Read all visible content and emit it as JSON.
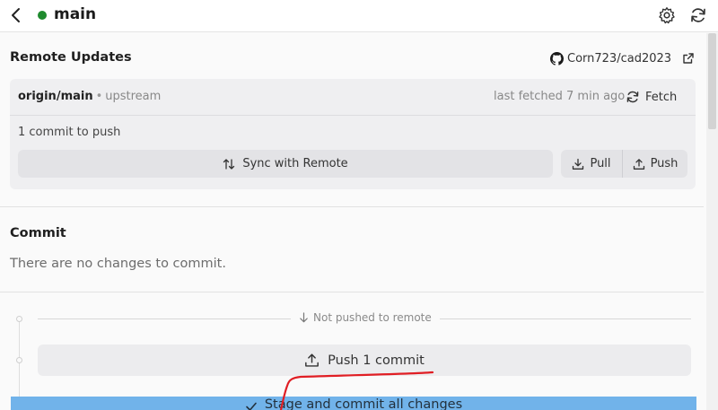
{
  "header": {
    "branch_name": "main",
    "status_color": "#1f8a2e",
    "back_icon": "chevron-left-icon",
    "settings_icon": "gear-icon",
    "refresh_icon": "refresh-icon"
  },
  "remote_updates": {
    "title": "Remote Updates",
    "repo_link": "Corn723/cad2023",
    "repo_icon": "github-icon",
    "external_icon": "external-link-icon",
    "upstream_branch": "origin/main",
    "separator": "•",
    "upstream_label": "upstream",
    "last_fetched": "last fetched 7 min ago",
    "fetch_label": "Fetch",
    "commits_to_push": "1 commit to push",
    "sync_label": "Sync with Remote",
    "pull_label": "Pull",
    "push_label": "Push"
  },
  "commit": {
    "title": "Commit",
    "empty_message": "There are no changes to commit.",
    "not_pushed_label": "Not pushed to remote",
    "push_commit_label": "Push 1 commit",
    "stage_commit_label": "Stage and commit all changes"
  },
  "colors": {
    "accent": "#71b3ea",
    "annotation": "#e01e24"
  }
}
